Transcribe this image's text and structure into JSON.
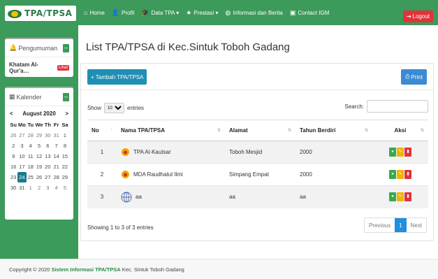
{
  "brand": {
    "name": "TPA/TPSA"
  },
  "nav": {
    "items": [
      {
        "label": "Home",
        "icon": "home-icon"
      },
      {
        "label": "Profil",
        "icon": "user-icon"
      },
      {
        "label": "Data TPA ▾",
        "icon": "graduation-cap-icon"
      },
      {
        "label": "Prestasi ▾",
        "icon": "star-icon"
      },
      {
        "label": "Informasi dan Berita",
        "icon": "globe-icon"
      },
      {
        "label": "Contact IGM",
        "icon": "contact-card-icon"
      }
    ],
    "logout": "Logout"
  },
  "sidebar": {
    "announce_title": "Pengumuman",
    "announce_item": "Khatam Al-Qur'a…",
    "announce_badge": "Lihat",
    "calendar_title": "Kalender",
    "calendar_month": "August 2020",
    "calendar_prev": "<",
    "calendar_next": ">",
    "day_headers": [
      "Su",
      "Mo",
      "Tu",
      "We",
      "Th",
      "Fr",
      "Sa"
    ],
    "days": [
      {
        "d": "26",
        "m": true
      },
      {
        "d": "27",
        "m": true
      },
      {
        "d": "28",
        "m": true
      },
      {
        "d": "29",
        "m": true
      },
      {
        "d": "30",
        "m": true
      },
      {
        "d": "31",
        "m": true
      },
      {
        "d": "1"
      },
      {
        "d": "2"
      },
      {
        "d": "3"
      },
      {
        "d": "4"
      },
      {
        "d": "5"
      },
      {
        "d": "6"
      },
      {
        "d": "7"
      },
      {
        "d": "8"
      },
      {
        "d": "9"
      },
      {
        "d": "10"
      },
      {
        "d": "11"
      },
      {
        "d": "12"
      },
      {
        "d": "13"
      },
      {
        "d": "14"
      },
      {
        "d": "15"
      },
      {
        "d": "16"
      },
      {
        "d": "17"
      },
      {
        "d": "18"
      },
      {
        "d": "19"
      },
      {
        "d": "20"
      },
      {
        "d": "21"
      },
      {
        "d": "22"
      },
      {
        "d": "23"
      },
      {
        "d": "24",
        "today": true
      },
      {
        "d": "25"
      },
      {
        "d": "26"
      },
      {
        "d": "27"
      },
      {
        "d": "28"
      },
      {
        "d": "29"
      },
      {
        "d": "30"
      },
      {
        "d": "31"
      },
      {
        "d": "1",
        "m": true
      },
      {
        "d": "2",
        "m": true
      },
      {
        "d": "3",
        "m": true
      },
      {
        "d": "4",
        "m": true
      },
      {
        "d": "5",
        "m": true
      }
    ]
  },
  "main": {
    "title": "List TPA/TPSA di Kec.Sintuk Toboh Gadang",
    "add_button": "+ Tambah TPA/TPSA",
    "print_button": "Print",
    "show_label": "Show",
    "show_value": "10",
    "entries_label": "entries",
    "search_label": "Search:",
    "columns": [
      "No",
      "Nama TPA/TPSA",
      "Alamat",
      "Tahun Berdiri",
      "Aksi"
    ],
    "rows": [
      {
        "no": "1",
        "nama": "TPA Al-Kautsar",
        "alamat": "Toboh Mesjid",
        "tahun": "2000"
      },
      {
        "no": "2",
        "nama": "MDA Raudhatul Ilmi",
        "alamat": "Simpang Empat",
        "tahun": "2000"
      },
      {
        "no": "3",
        "nama": "aa",
        "alamat": "aa",
        "tahun": "aa"
      }
    ],
    "info": "Showing 1 to 3 of 3 entries",
    "pager": {
      "prev": "Previous",
      "page": "1",
      "next": "Next"
    }
  },
  "footer": {
    "prefix": "Copyright © 2020",
    "brand": "Sistem Informasi TPA/TPSA",
    "suffix": "Kec. Sintuk Toboh Gadang"
  },
  "colors": {
    "primary_green": "#3c9a5a",
    "logout_red": "#e0343c",
    "add_blue": "#1f8fb3"
  }
}
